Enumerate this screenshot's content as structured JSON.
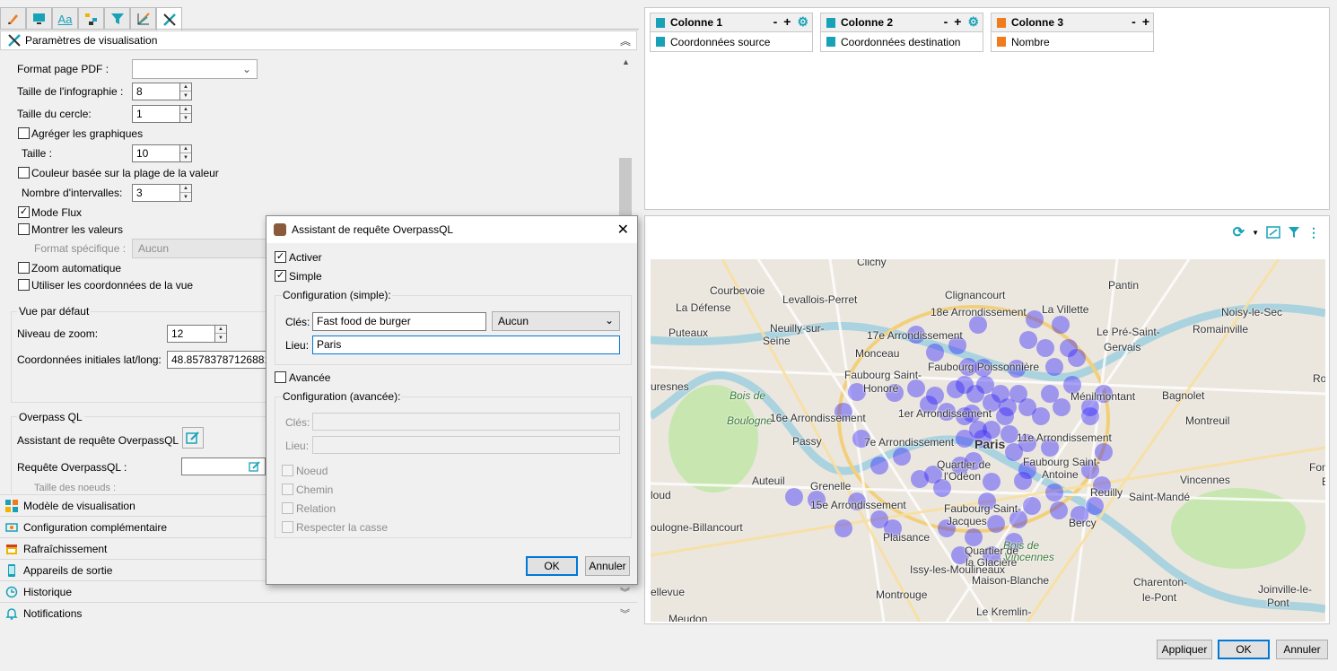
{
  "left_panel": {
    "section_title": "Paramètres de visualisation",
    "fields": {
      "format_pdf_label": "Format page PDF :",
      "format_pdf_value": "",
      "taille_infographie_label": "Taille de l'infographie :",
      "taille_infographie_value": "8",
      "taille_cercle_label": "Taille du cercle:",
      "taille_cercle_value": "1",
      "agreger_label": "Agréger les graphiques",
      "taille_label": "Taille :",
      "taille_value": "10",
      "couleur_label": "Couleur basée sur la plage de la valeur",
      "nb_intervalles_label": "Nombre d'intervalles:",
      "nb_intervalles_value": "3",
      "mode_flux_label": "Mode Flux",
      "montrer_valeurs_label": "Montrer les valeurs",
      "format_specifique_label": "Format spécifique :",
      "format_specifique_value": "Aucun",
      "zoom_auto_label": "Zoom automatique",
      "utiliser_coords_label": "Utiliser les coordonnées de la vue"
    },
    "vue_defaut": {
      "title": "Vue par défaut",
      "zoom_label": "Niveau de zoom:",
      "zoom_value": "12",
      "coords_label": "Coordonnées initiales lat/long:",
      "coords_value": "48.85783787126881,2"
    },
    "overpass": {
      "title": "Overpass QL",
      "assistant_label": "Assistant de requête OverpassQL :",
      "requete_label": "Requête OverpassQL :",
      "requete_value": "",
      "truncated_label": "Taille des noeuds :"
    },
    "accordions": [
      {
        "label": "Modèle de visualisation",
        "icon": "layout-icon"
      },
      {
        "label": "Configuration complémentaire",
        "icon": "config-icon"
      },
      {
        "label": "Rafraîchissement",
        "icon": "calendar-icon"
      },
      {
        "label": "Appareils de sortie",
        "icon": "device-icon"
      },
      {
        "label": "Historique",
        "icon": "history-icon"
      },
      {
        "label": "Notifications",
        "icon": "notification-icon"
      }
    ]
  },
  "columns": [
    {
      "header": "Colonne 1",
      "sub": "Coordonnées source",
      "color": "#17a2b8"
    },
    {
      "header": "Colonne 2",
      "sub": "Coordonnées destination",
      "color": "#17a2b8"
    },
    {
      "header": "Colonne 3",
      "sub": "Nombre",
      "color": "#f07c1e"
    }
  ],
  "column_btns": {
    "minus": "-",
    "plus": "+"
  },
  "map": {
    "labels": [
      {
        "t": "Clichy"
      },
      {
        "t": "Courbevoie"
      },
      {
        "t": "Levallois-Perret"
      },
      {
        "t": "Pantin"
      },
      {
        "t": "La Défense"
      },
      {
        "t": "Clignancourt"
      },
      {
        "t": "18e Arrondissement"
      },
      {
        "t": "La Villette"
      },
      {
        "t": "Noisy-le-Sec"
      },
      {
        "t": "Puteaux"
      },
      {
        "t": "Neuilly-sur-"
      },
      {
        "t": "Seine"
      },
      {
        "t": "17e Arrondissement"
      },
      {
        "t": "Le Pré-Saint-"
      },
      {
        "t": "Gervais"
      },
      {
        "t": "Romainville"
      },
      {
        "t": "Monceau"
      },
      {
        "t": "Faubourg Poissonnière"
      },
      {
        "t": "Faubourg Saint-"
      },
      {
        "t": "Honoré"
      },
      {
        "t": "uresnes"
      },
      {
        "t": "Ménilmontant"
      },
      {
        "t": "Bagnolet"
      },
      {
        "t": "Ro"
      },
      {
        "t": "Bois de"
      },
      {
        "t": "Boulogne"
      },
      {
        "t": "16e Arrondissement"
      },
      {
        "t": "1er Arrondissement"
      },
      {
        "t": "Montreuil"
      },
      {
        "t": "Passy"
      },
      {
        "t": "7e Arrondissement"
      },
      {
        "t": "Paris"
      },
      {
        "t": "11e Arrondissement"
      },
      {
        "t": "Faubourg Saint-"
      },
      {
        "t": "Antoine"
      },
      {
        "t": "Quartier de"
      },
      {
        "t": "l'Odéon"
      },
      {
        "t": "Auteuil"
      },
      {
        "t": "Grenelle"
      },
      {
        "t": "Fontenay-"
      },
      {
        "t": "Bois"
      },
      {
        "t": "Vincennes"
      },
      {
        "t": "loud"
      },
      {
        "t": "Reuilly"
      },
      {
        "t": "15e Arrondissement"
      },
      {
        "t": "Faubourg Saint-"
      },
      {
        "t": "Jacques"
      },
      {
        "t": "Saint-Mandé"
      },
      {
        "t": "Bercy"
      },
      {
        "t": "oulogne-Billancourt"
      },
      {
        "t": "Plaisance"
      },
      {
        "t": "Bois de"
      },
      {
        "t": "Vincennes"
      },
      {
        "t": "Quartier de"
      },
      {
        "t": "la Glacière"
      },
      {
        "t": "Issy-les-Moulineaux"
      },
      {
        "t": "Maison-Blanche"
      },
      {
        "t": "Charenton-"
      },
      {
        "t": "le-Pont"
      },
      {
        "t": "ellevue"
      },
      {
        "t": "Montrouge"
      },
      {
        "t": "Joinville-le-"
      },
      {
        "t": "Pont"
      },
      {
        "t": "Le Kremlin-"
      },
      {
        "t": "Meudon"
      }
    ]
  },
  "dialog": {
    "title": "Assistant de requête OverpassQL",
    "activer": "Activer",
    "simple": "Simple",
    "config_simple": "Configuration (simple):",
    "cles_label": "Clés:",
    "cles_value": "Fast food de burger",
    "cles_combo": "Aucun",
    "lieu_label": "Lieu:",
    "lieu_value": "Paris",
    "avancee": "Avancée",
    "config_avancee": "Configuration (avancée):",
    "cles_adv_label": "Clés:",
    "lieu_adv_label": "Lieu:",
    "noeud": "Noeud",
    "chemin": "Chemin",
    "relation": "Relation",
    "respecter": "Respecter la casse",
    "ok": "OK",
    "annuler": "Annuler"
  },
  "footer": {
    "appliquer": "Appliquer",
    "ok": "OK",
    "annuler": "Annuler"
  },
  "colors": {
    "accent": "#0078d7",
    "teal": "#17a2b8",
    "orange": "#f07c1e",
    "marker": "#2a1bff"
  }
}
